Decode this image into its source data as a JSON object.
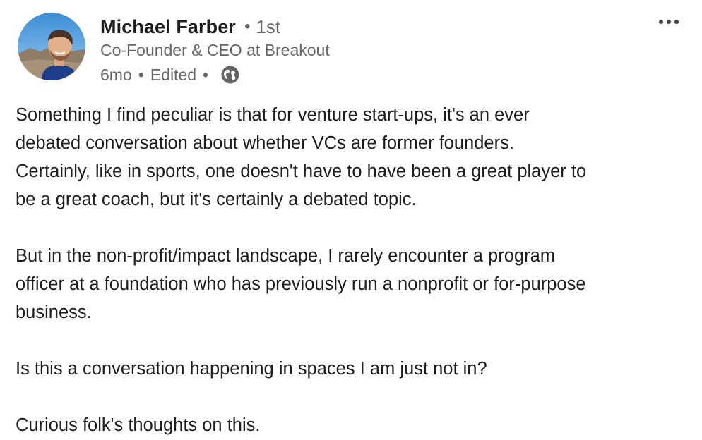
{
  "author": {
    "name": "Michael Farber",
    "degree": "1st",
    "headline": "Co-Founder & CEO at Breakout",
    "avatar_icon": "profile-photo",
    "separator": "•"
  },
  "meta": {
    "age": "6mo",
    "edited": "Edited",
    "visibility_icon": "globe-icon"
  },
  "menu": {
    "icon": "more-horizontal-icon"
  },
  "post": {
    "paragraphs": [
      {
        "lines": [
          "Something I find peculiar is that for venture start-ups, it's an ever",
          "debated conversation about whether VCs are former founders.",
          "Certainly, like in sports, one doesn't have to have been a great player to",
          "be a great coach, but it's certainly a debated topic."
        ]
      },
      {
        "lines": [
          "But in the non-profit/impact landscape, I rarely encounter a program",
          "officer at a foundation who has previously run a nonprofit or for-purpose",
          "business."
        ]
      },
      {
        "lines": [
          "Is this a conversation happening in spaces I am just not in?"
        ]
      },
      {
        "lines": [
          "Curious folk's thoughts on this."
        ]
      }
    ]
  },
  "colors": {
    "text_primary": "#1d1d1d",
    "text_secondary": "#666666",
    "background": "#ffffff"
  }
}
